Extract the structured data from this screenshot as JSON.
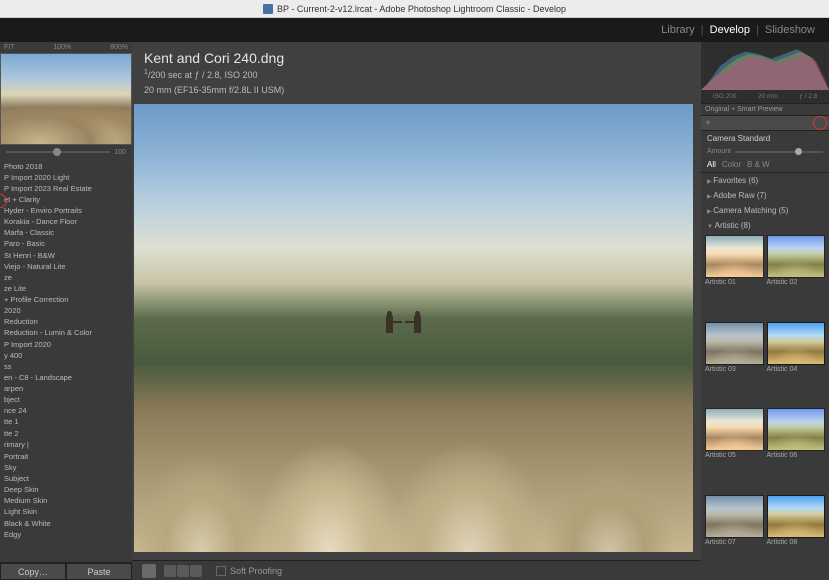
{
  "titlebar": {
    "text": "BP - Current-2-v12.lrcat - Adobe Photoshop Lightroom Classic - Develop"
  },
  "modules": {
    "items": [
      "Library",
      "Develop",
      "Slideshow"
    ],
    "active": "Develop"
  },
  "navigator": {
    "fit": "FIT",
    "pct100": "100%",
    "pct800": "800%"
  },
  "zoom": {
    "value": "100"
  },
  "presets": [
    "Photo 2018",
    "P Import 2020 Light",
    "P Import 2023 Real Estate",
    "et + Clarity",
    "Hyder - Enviro Portraits",
    "Korakia - Dance Floor",
    "Marfa - Classic",
    "Paro - Basic",
    "St Henri - B&W",
    "Viejo - Natural Lite",
    "ze",
    "ze Lite",
    "+ Profile Correction",
    "2020",
    "Reduction",
    "Reduction - Lumin & Color",
    "P Import 2020",
    "y 400",
    "ss",
    "en - C8 - Landscape",
    "arpen",
    "bject",
    "nce 24",
    "tte 1",
    "tte 2",
    "rimary |",
    "",
    "Portrait",
    "Sky",
    "Subject",
    "Deep Skin",
    "Medium Skin",
    "Light Skin",
    "Black & White",
    "Edgy"
  ],
  "copypaste": {
    "copy": "Copy…",
    "paste": "Paste"
  },
  "image": {
    "filename": "Kent and Cori 240.dng",
    "exposure_line": "sec at ƒ / 2.8, ISO 200",
    "exposure_frac_num": "1",
    "exposure_frac_den": "200",
    "lens_line": "20 mm (EF16-35mm f/2.8L II USM)"
  },
  "toolbar": {
    "softproof": "Soft Proofing"
  },
  "histogram": {
    "iso": "ISO 200",
    "focal": "20 mm",
    "aperture": "ƒ / 2.8"
  },
  "smartpreview": "Original + Smart Preview",
  "profile": {
    "name": "Camera Standard",
    "amount_label": "Amount"
  },
  "filter_tabs": {
    "all": "All",
    "color": "Color",
    "bw": "B & W",
    "active": "All"
  },
  "profile_groups": {
    "favorites": "Favorites (6)",
    "adoberaw": "Adobe Raw (7)",
    "cameramatching": "Camera Matching (5)",
    "artistic": "Artistic (8)"
  },
  "artistic_profiles": [
    {
      "label": "Artistic 01",
      "variant": "warm"
    },
    {
      "label": "Artistic 02",
      "variant": "cool"
    },
    {
      "label": "Artistic 03",
      "variant": "muted"
    },
    {
      "label": "Artistic 04",
      "variant": "vivid"
    },
    {
      "label": "Artistic 05",
      "variant": "warm"
    },
    {
      "label": "Artistic 06",
      "variant": "cool"
    },
    {
      "label": "Artistic 07",
      "variant": "muted"
    },
    {
      "label": "Artistic 08",
      "variant": "vivid"
    }
  ]
}
